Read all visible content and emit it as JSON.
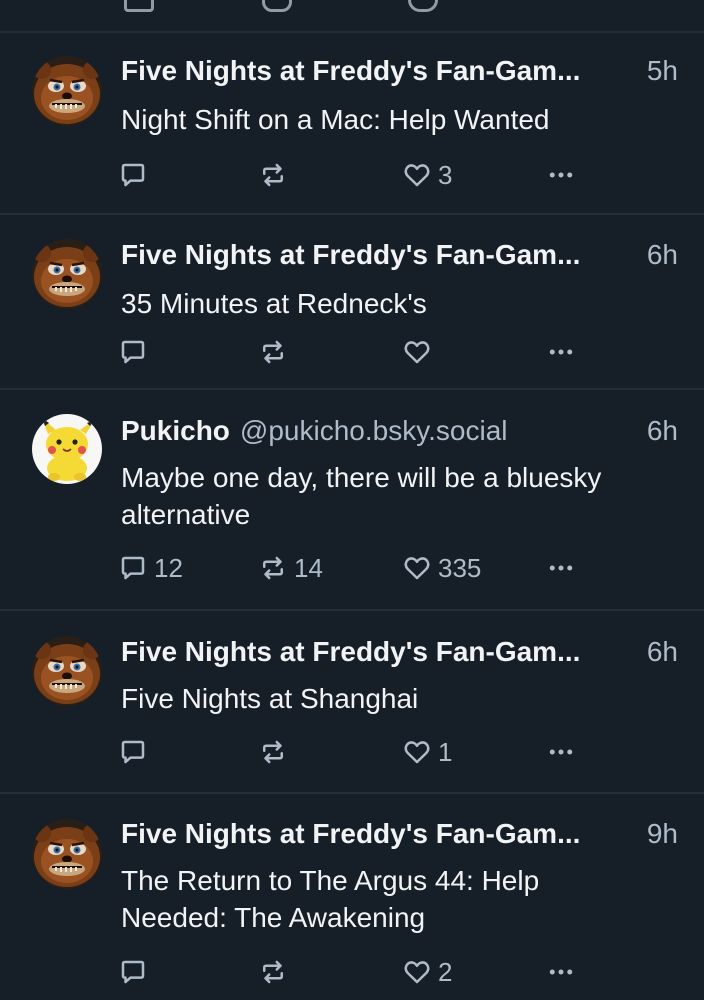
{
  "colors": {
    "background": "#161e27",
    "divider": "#232e3b",
    "text_primary": "#f1f3f5",
    "text_secondary": "#aebbc9"
  },
  "icons": {
    "reply": "reply-icon",
    "repost": "repost-icon",
    "like": "heart-icon",
    "more": "more-icon"
  },
  "posts": [
    {
      "author": "Five Nights at Freddy's Fan-Gam...",
      "handle": "",
      "time": "5h",
      "text": "Night Shift on a Mac: Help Wanted",
      "avatar": "freddy-avatar",
      "replies": "",
      "reposts": "",
      "likes": "3"
    },
    {
      "author": "Five Nights at Freddy's Fan-Gam...",
      "handle": "",
      "time": "6h",
      "text": "35 Minutes at Redneck's",
      "avatar": "freddy-avatar",
      "replies": "",
      "reposts": "",
      "likes": ""
    },
    {
      "author": "Pukicho",
      "handle": "@pukicho.bsky.social",
      "time": "6h",
      "text": "Maybe one day, there will be a bluesky alternative",
      "avatar": "pikachu-avatar",
      "replies": "12",
      "reposts": "14",
      "likes": "335"
    },
    {
      "author": "Five Nights at Freddy's Fan-Gam...",
      "handle": "",
      "time": "6h",
      "text": "Five Nights at Shanghai",
      "avatar": "freddy-avatar",
      "replies": "",
      "reposts": "",
      "likes": "1"
    },
    {
      "author": "Five Nights at Freddy's Fan-Gam...",
      "handle": "",
      "time": "9h",
      "text": "The Return to The Argus 44: Help Needed: The Awakening",
      "avatar": "freddy-avatar",
      "replies": "",
      "reposts": "",
      "likes": "2"
    }
  ]
}
